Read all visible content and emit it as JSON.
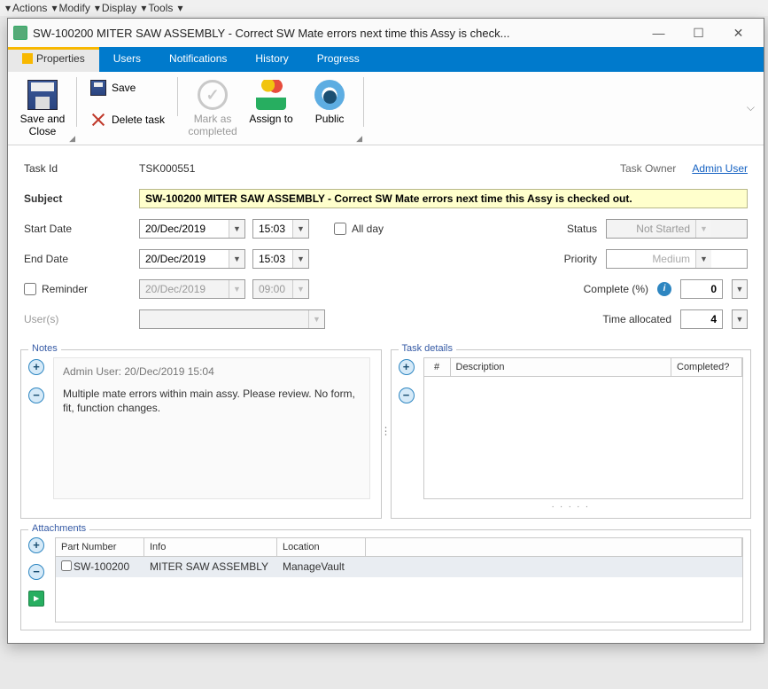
{
  "bg_menu": [
    "Actions",
    "Modify",
    "Display",
    "Tools"
  ],
  "titlebar": {
    "title": "SW-100200 MITER SAW ASSEMBLY - Correct SW Mate errors next time this Assy is check..."
  },
  "tabs": {
    "properties": "Properties",
    "users": "Users",
    "notifications": "Notifications",
    "history": "History",
    "progress": "Progress"
  },
  "ribbon": {
    "save_and_close": "Save and Close",
    "save": "Save",
    "delete_task": "Delete task",
    "mark_as_completed": "Mark as completed",
    "assign_to": "Assign to",
    "public": "Public"
  },
  "form": {
    "task_id_label": "Task Id",
    "task_id": "TSK000551",
    "task_owner_label": "Task Owner",
    "task_owner": "Admin User",
    "subject_label": "Subject",
    "subject": "SW-100200 MITER SAW ASSEMBLY - Correct SW Mate errors next time this Assy is checked out.",
    "start_date_label": "Start Date",
    "start_date": "20/Dec/2019",
    "start_time": "15:03",
    "all_day_label": "All day",
    "end_date_label": "End Date",
    "end_date": "20/Dec/2019",
    "end_time": "15:03",
    "reminder_label": "Reminder",
    "reminder_date": "20/Dec/2019",
    "reminder_time": "09:00",
    "users_label": "User(s)",
    "status_label": "Status",
    "status": "Not Started",
    "priority_label": "Priority",
    "priority": "Medium",
    "complete_label": "Complete (%)",
    "complete": "0",
    "time_allocated_label": "Time allocated",
    "time_allocated": "4"
  },
  "notes": {
    "legend": "Notes",
    "meta": "Admin User: 20/Dec/2019 15:04",
    "text": "Multiple mate errors within main assy. Please review. No form, fit, function changes."
  },
  "details": {
    "legend": "Task details",
    "col_hash": "#",
    "col_desc": "Description",
    "col_completed": "Completed?"
  },
  "attachments": {
    "legend": "Attachments",
    "col_part": "Part Number",
    "col_info": "Info",
    "col_location": "Location",
    "rows": [
      {
        "part": "SW-100200",
        "info": "MITER SAW ASSEMBLY",
        "location": "ManageVault"
      }
    ]
  }
}
